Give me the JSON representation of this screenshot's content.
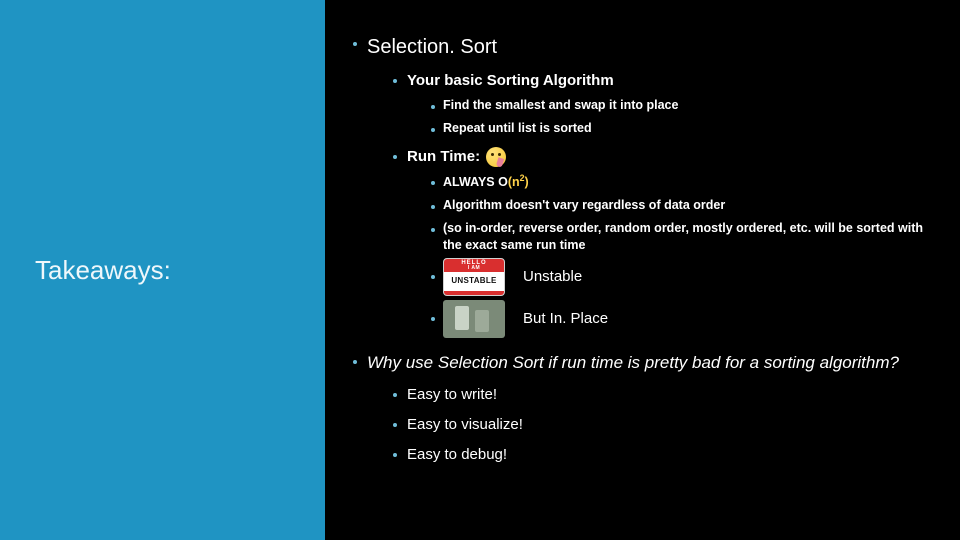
{
  "sidebar": {
    "title": "Takeaways:"
  },
  "main": {
    "h1": "Selection. Sort",
    "sub1": "Your basic Sorting Algorithm",
    "sub1a": "Find the smallest and swap it into place",
    "sub1b": "Repeat until list is sorted",
    "sub2": "Run Time:",
    "sub2a_prefix": "ALWAYS O",
    "sub2a_big": "(n",
    "sub2a_exp": "2",
    "sub2a_suffix": ")",
    "sub2b": "Algorithm doesn't vary regardless of data order",
    "sub2c": "(so in-order, reverse order, random order, mostly ordered, etc. will be sorted with the exact same run time",
    "sticker_hello": "HELLO",
    "sticker_iam": "I AM",
    "sticker_text": "UNSTABLE",
    "unstable_label": "Unstable",
    "inplace_label": "But In. Place",
    "h2": "Why use Selection Sort if run time is pretty bad for a sorting algorithm?",
    "why1": "Easy to write!",
    "why2": "Easy to visualize!",
    "why3": "Easy to debug!"
  }
}
